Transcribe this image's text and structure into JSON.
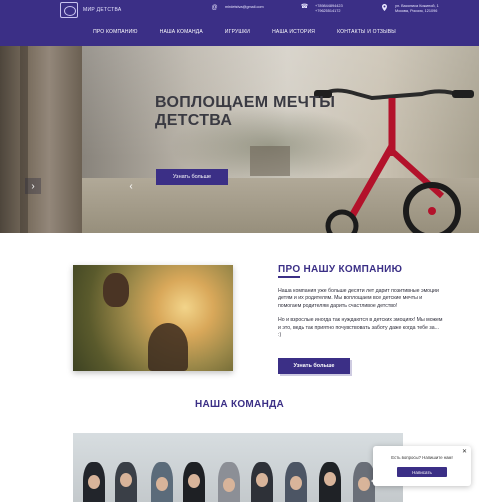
{
  "header": {
    "logo_text": "МИР ДЕТСТВА",
    "email": "mirdetstva@gmail.com",
    "phones": [
      "+78984489442З",
      "+79625514172"
    ],
    "address_lines": [
      "ул. Василиса Кожиной, 1",
      "Москва, Россия, 121096"
    ],
    "icons": {
      "email": "at-icon",
      "phone": "phone-icon",
      "address": "map-pin-icon"
    }
  },
  "nav": {
    "items": [
      {
        "label": "ПРО КОМПАНИЮ"
      },
      {
        "label": "НАША КОМАНДА"
      },
      {
        "label": "ИГРУШКИ"
      },
      {
        "label": "НАША ИСТОРИЯ"
      },
      {
        "label": "КОНТАКТЫ И ОТЗЫВЫ"
      }
    ]
  },
  "hero": {
    "title_line1": "ВОПЛОЩАЕМ МЕЧТЫ",
    "title_line2": "ДЕТСТВА",
    "button": "Узнать больше",
    "prev_arrow": "‹",
    "next_arrow": "›"
  },
  "about": {
    "title": "ПРО НАШУ КОМПАНИЮ",
    "paragraph1": "Наша компания уже больше десяти лет дарит позитивные эмоции детям и их родителям. Мы воплощаем все детские мечты и помогаем родителям дарить счастливое детство!",
    "paragraph2": "Но и взрослые иногда так нуждаются в детских эмоциях! Мы можем и это, ведь так приятно почувствовать заботу даже когда тебе за... :)",
    "button": "Узнать больше"
  },
  "team": {
    "title": "НАША КОМАНДА"
  },
  "chat_widget": {
    "close": "✕",
    "text": "Есть вопросы? Напишите нам!",
    "button": "Написать"
  },
  "colors": {
    "brand": "#3b2f86",
    "background": "#ffffff"
  }
}
